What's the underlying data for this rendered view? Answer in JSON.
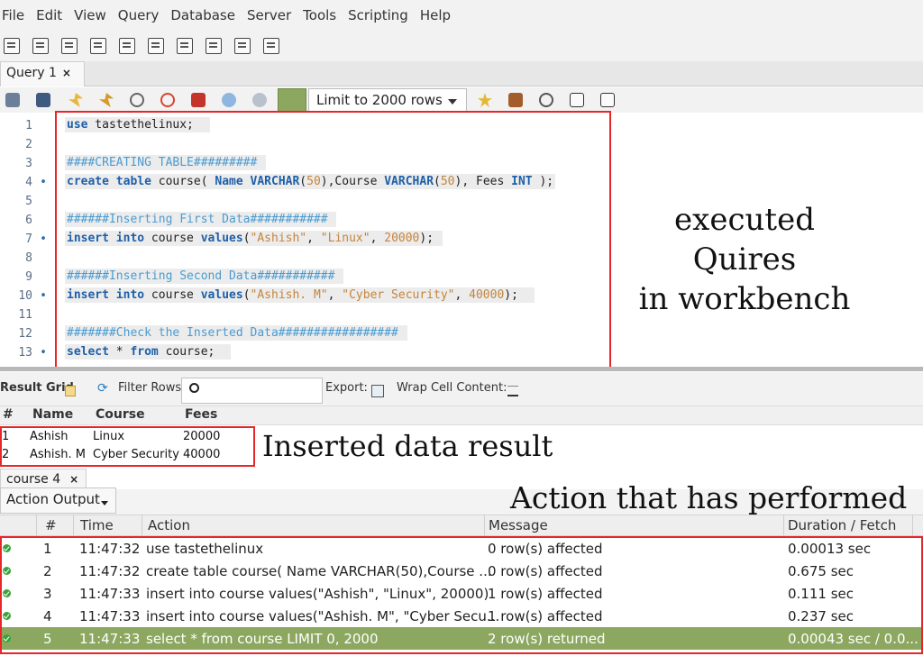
{
  "menu": [
    "File",
    "Edit",
    "View",
    "Query",
    "Database",
    "Server",
    "Tools",
    "Scripting",
    "Help"
  ],
  "query_tab": {
    "label": "Query 1",
    "close": "×"
  },
  "limit_select": {
    "value": "Limit to 2000 rows"
  },
  "editor": {
    "line_numbers": [
      "1",
      "2",
      "3",
      "4",
      "5",
      "6",
      "7",
      "8",
      "9",
      "10",
      "11",
      "12",
      "13"
    ]
  },
  "annotations": {
    "queries": "executed Quires in workbench",
    "queries_l1": "executed Quires",
    "queries_l2": "in workbench",
    "inserted": "Inserted data result",
    "actions": "Action that has performed"
  },
  "result_bar": {
    "grid_label": "Result Grid",
    "filter_label": "Filter Rows:",
    "export_label": "Export:",
    "wrap_label": "Wrap Cell Content:"
  },
  "result_grid": {
    "headers": [
      "#",
      "Name",
      "Course",
      "Fees"
    ],
    "rows": [
      [
        "1",
        "Ashish",
        "Linux",
        "20000"
      ],
      [
        "2",
        "Ashish. M",
        "Cyber Security",
        "40000"
      ]
    ]
  },
  "result_tab": {
    "label": "course 4",
    "close": "×"
  },
  "output": {
    "selector": "Action Output",
    "headers": [
      "#",
      "Time",
      "Action",
      "Message",
      "Duration / Fetch"
    ],
    "rows": [
      {
        "n": "1",
        "time": "11:47:32",
        "action": "use tastethelinux",
        "message": "0 row(s) affected",
        "duration": "0.00013 sec"
      },
      {
        "n": "2",
        "time": "11:47:32",
        "action": "create table course( Name VARCHAR(50),Course ...",
        "message": "0 row(s) affected",
        "duration": "0.675 sec"
      },
      {
        "n": "3",
        "time": "11:47:33",
        "action": "insert into course values(\"Ashish\", \"Linux\", 20000)",
        "message": "1 row(s) affected",
        "duration": "0.111 sec"
      },
      {
        "n": "4",
        "time": "11:47:33",
        "action": "insert into course values(\"Ashish. M\", \"Cyber Secu...",
        "message": "1 row(s) affected",
        "duration": "0.237 sec"
      },
      {
        "n": "5",
        "time": "11:47:33",
        "action": "select * from course LIMIT 0, 2000",
        "message": "2 row(s) returned",
        "duration": "0.00043 sec / 0.0..."
      }
    ]
  }
}
